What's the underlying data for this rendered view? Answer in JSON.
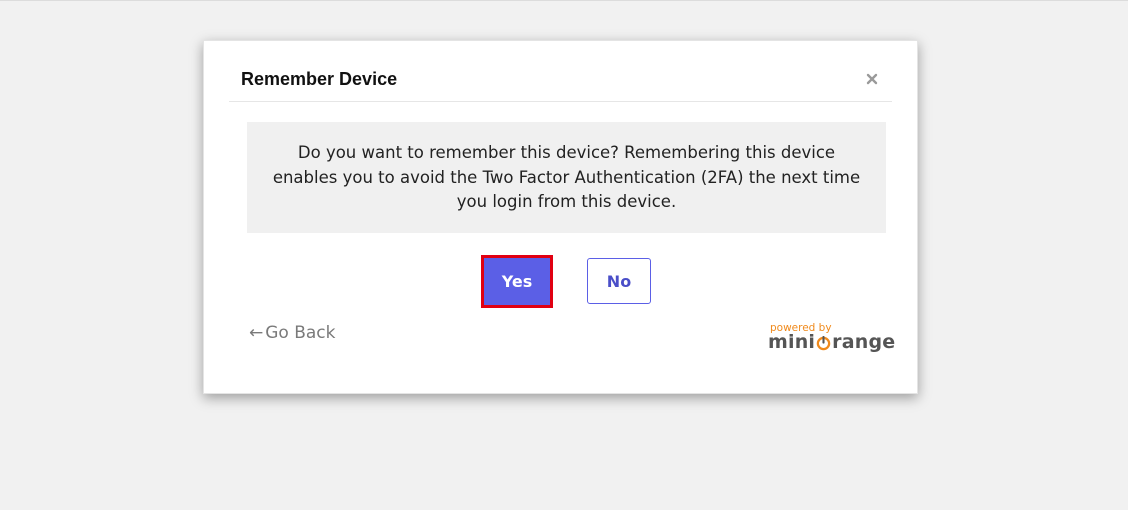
{
  "dialog": {
    "title": "Remember Device",
    "message": "Do you want to remember this device? Remembering this device enables you to avoid the Two Factor Authentication (2FA) the next time you login from this device.",
    "yes_label": "Yes",
    "no_label": "No",
    "go_back_arrow": "←",
    "go_back_label": "Go Back",
    "close_icon": "close-icon"
  },
  "branding": {
    "powered_by": "powered by",
    "brand_pre": "mini",
    "brand_post": "range",
    "brand_name": "miniOrange",
    "accent_color": "#f08a1c"
  },
  "colors": {
    "primary_button": "#5b5fe6",
    "highlight_border": "#e10012",
    "message_background": "#f0f0f0"
  }
}
